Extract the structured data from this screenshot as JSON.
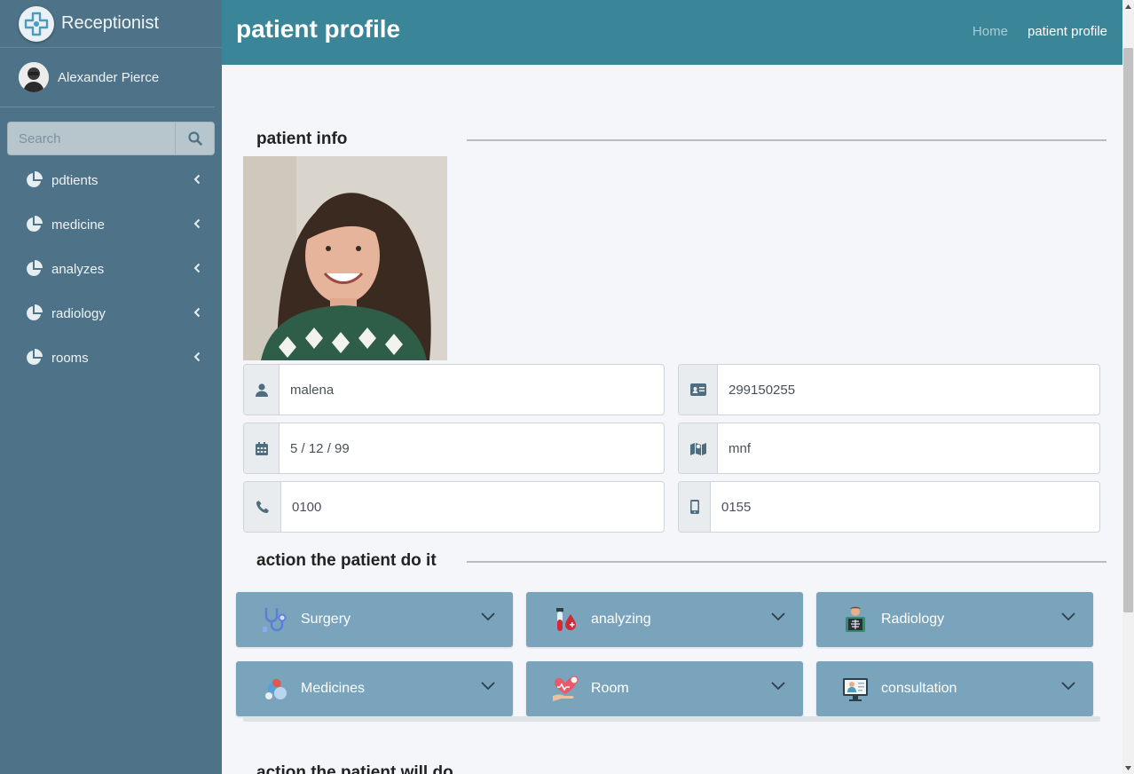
{
  "sidebar": {
    "brand": "Receptionist",
    "user_name": "Alexander Pierce",
    "search_placeholder": "Search",
    "items": [
      {
        "label": "pdtients"
      },
      {
        "label": "medicine"
      },
      {
        "label": "analyzes"
      },
      {
        "label": "radiology"
      },
      {
        "label": "rooms"
      }
    ]
  },
  "header": {
    "title": "patient profile",
    "breadcrumb_home": "Home",
    "breadcrumb_current": "patient profile"
  },
  "patient_info": {
    "section_title": "patient info",
    "name": "malena",
    "id_number": "299150255",
    "birth_date": "5 / 12 / 99",
    "address": "mnf",
    "phone": "0100",
    "mobile": "0155"
  },
  "actions_done": {
    "section_title": "action the patient do it",
    "items": [
      {
        "label": "Surgery",
        "icon": "stethoscope-icon"
      },
      {
        "label": "analyzing",
        "icon": "blood-test-icon"
      },
      {
        "label": "Radiology",
        "icon": "xray-icon"
      },
      {
        "label": "Medicines",
        "icon": "pills-icon"
      },
      {
        "label": "Room",
        "icon": "heart-hand-icon"
      },
      {
        "label": "consultation",
        "icon": "doctor-monitor-icon"
      }
    ]
  },
  "actions_future": {
    "section_title": "action the patient will do"
  },
  "colors": {
    "sidebar": "#4e7388",
    "header": "#3b8599",
    "action_card": "#7aa4bc",
    "content_bg": "#f4f6f9"
  }
}
